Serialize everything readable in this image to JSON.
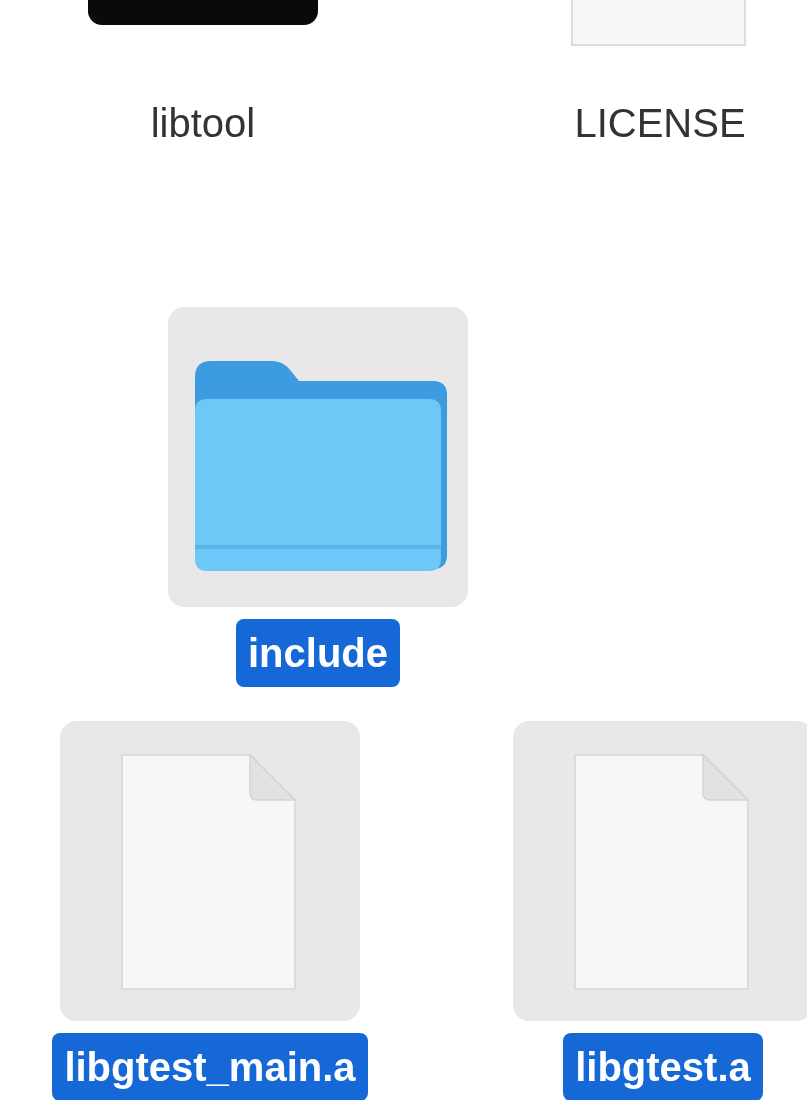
{
  "rows": [
    {
      "items": [
        {
          "name": "libtool",
          "kind": "executable",
          "selected": false
        },
        {
          "name": "LICENSE",
          "kind": "document",
          "selected": false
        }
      ]
    },
    {
      "items": [
        {
          "name": "include",
          "kind": "folder",
          "selected": true
        }
      ]
    },
    {
      "items": [
        {
          "name": "libgtest_main.a",
          "kind": "document",
          "selected": true
        },
        {
          "name": "libgtest.a",
          "kind": "document",
          "selected": true
        }
      ]
    }
  ]
}
